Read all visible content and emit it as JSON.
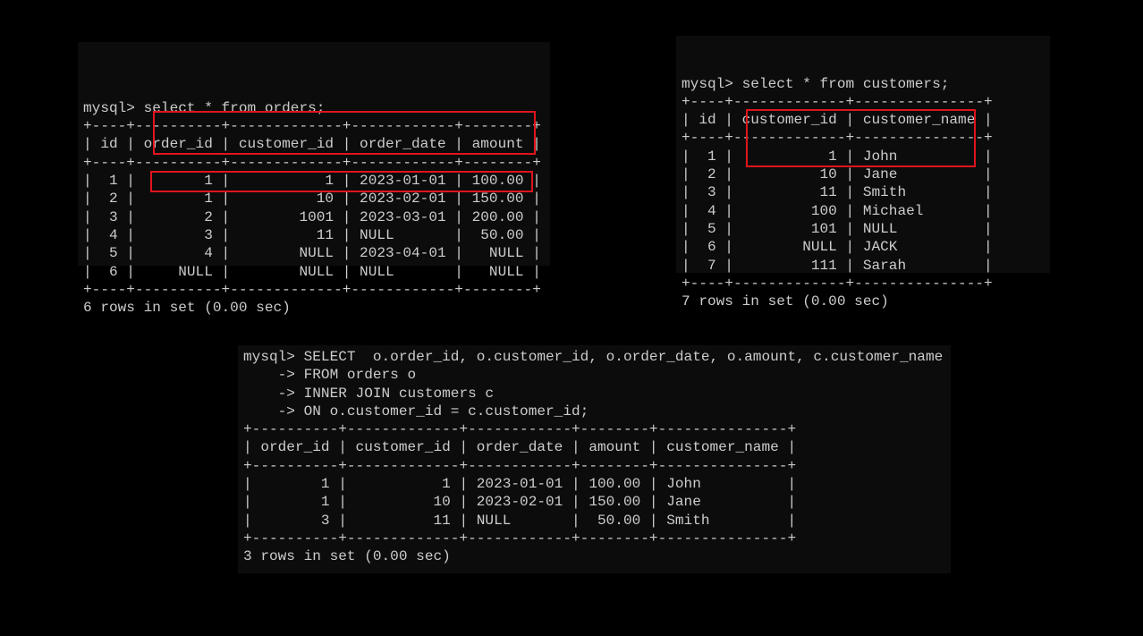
{
  "panels": [
    {
      "command": [
        "mysql> select * from orders;"
      ],
      "columns": [
        {
          "name": "id",
          "align": "right"
        },
        {
          "name": "order_id",
          "align": "right"
        },
        {
          "name": "customer_id",
          "align": "right"
        },
        {
          "name": "order_date",
          "align": "left"
        },
        {
          "name": "amount",
          "align": "right"
        }
      ],
      "rows": [
        [
          "1",
          "1",
          "1",
          "2023-01-01",
          "100.00"
        ],
        [
          "2",
          "1",
          "10",
          "2023-02-01",
          "150.00"
        ],
        [
          "3",
          "2",
          "1001",
          "2023-03-01",
          "200.00"
        ],
        [
          "4",
          "3",
          "11",
          "NULL",
          "50.00"
        ],
        [
          "5",
          "4",
          "NULL",
          "2023-04-01",
          "NULL"
        ],
        [
          "6",
          "NULL",
          "NULL",
          "NULL",
          "NULL"
        ]
      ],
      "footer": "6 rows in set (0.00 sec)"
    },
    {
      "command": [
        "mysql> select * from customers;"
      ],
      "columns": [
        {
          "name": "id",
          "align": "right"
        },
        {
          "name": "customer_id",
          "align": "right"
        },
        {
          "name": "customer_name",
          "align": "left"
        }
      ],
      "rows": [
        [
          "1",
          "1",
          "John"
        ],
        [
          "2",
          "10",
          "Jane"
        ],
        [
          "3",
          "11",
          "Smith"
        ],
        [
          "4",
          "100",
          "Michael"
        ],
        [
          "5",
          "101",
          "NULL"
        ],
        [
          "6",
          "NULL",
          "JACK"
        ],
        [
          "7",
          "111",
          "Sarah"
        ]
      ],
      "footer": "7 rows in set (0.00 sec)"
    },
    {
      "command": [
        "mysql> SELECT  o.order_id, o.customer_id, o.order_date, o.amount, c.customer_name",
        "    -> FROM orders o",
        "    -> INNER JOIN customers c",
        "    -> ON o.customer_id = c.customer_id;"
      ],
      "columns": [
        {
          "name": "order_id",
          "align": "right"
        },
        {
          "name": "customer_id",
          "align": "right"
        },
        {
          "name": "order_date",
          "align": "left"
        },
        {
          "name": "amount",
          "align": "right"
        },
        {
          "name": "customer_name",
          "align": "left"
        }
      ],
      "rows": [
        [
          "1",
          "1",
          "2023-01-01",
          "100.00",
          "John"
        ],
        [
          "1",
          "10",
          "2023-02-01",
          "150.00",
          "Jane"
        ],
        [
          "3",
          "11",
          "NULL",
          "50.00",
          "Smith"
        ]
      ],
      "footer": "3 rows in set (0.00 sec)"
    }
  ],
  "highlight_color": "#e0141e",
  "text_color": "#cccccc",
  "panel_background": "#0c0c0c"
}
